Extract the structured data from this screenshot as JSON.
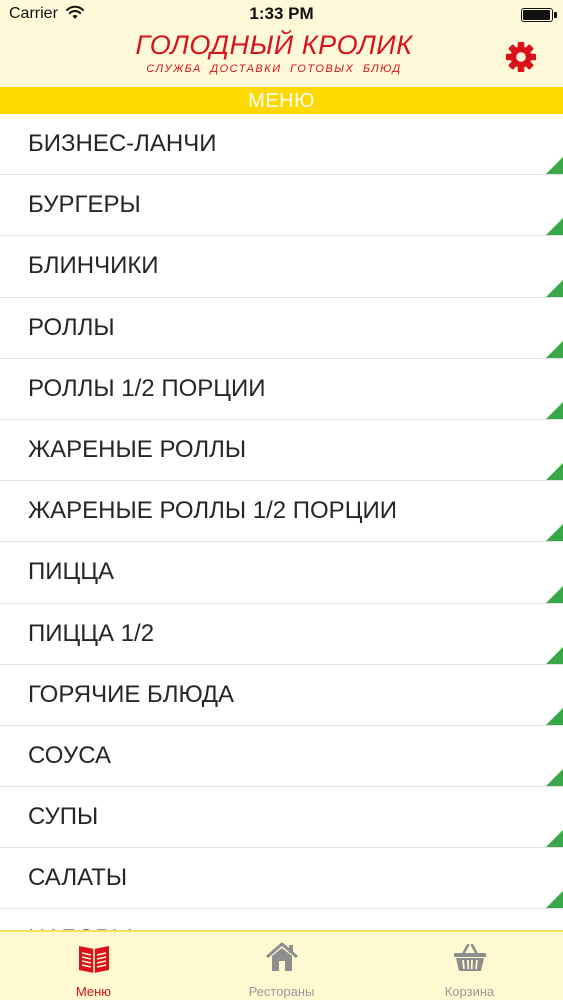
{
  "status_bar": {
    "carrier": "Carrier",
    "time": "1:33 PM",
    "battery_level": 0.95
  },
  "header": {
    "title": "ГОЛОДНЫЙ КРОЛИК",
    "subtitle": "СЛУЖБА ДОСТАВКИ ГОТОВЫХ БЛЮД",
    "settings_icon": "gear-icon"
  },
  "menu_banner": "МЕНЮ",
  "menu_items": [
    {
      "label": "БИЗНЕС-ЛАНЧИ"
    },
    {
      "label": "БУРГЕРЫ"
    },
    {
      "label": "БЛИНЧИКИ"
    },
    {
      "label": "РОЛЛЫ"
    },
    {
      "label": "РОЛЛЫ 1/2 ПОРЦИИ"
    },
    {
      "label": "ЖАРЕНЫЕ РОЛЛЫ"
    },
    {
      "label": "ЖАРЕНЫЕ РОЛЛЫ 1/2 ПОРЦИИ"
    },
    {
      "label": "ПИЦЦА"
    },
    {
      "label": "ПИЦЦА 1/2"
    },
    {
      "label": "ГОРЯЧИЕ БЛЮДА"
    },
    {
      "label": "СОУСА"
    },
    {
      "label": "СУПЫ"
    },
    {
      "label": "САЛАТЫ"
    },
    {
      "label": "НАБОРЫ"
    }
  ],
  "tabs": [
    {
      "label": "Меню",
      "icon": "menu-book-icon",
      "active": true
    },
    {
      "label": "Рестораны",
      "icon": "house-icon",
      "active": false
    },
    {
      "label": "Корзина",
      "icon": "basket-icon",
      "active": false
    }
  ],
  "colors": {
    "brand_red": "#d8111b",
    "banner_yellow": "#ffd800",
    "corner_green": "#3aa84a",
    "header_bg": "#fef9d8",
    "tab_inactive": "#9a9a9a"
  }
}
